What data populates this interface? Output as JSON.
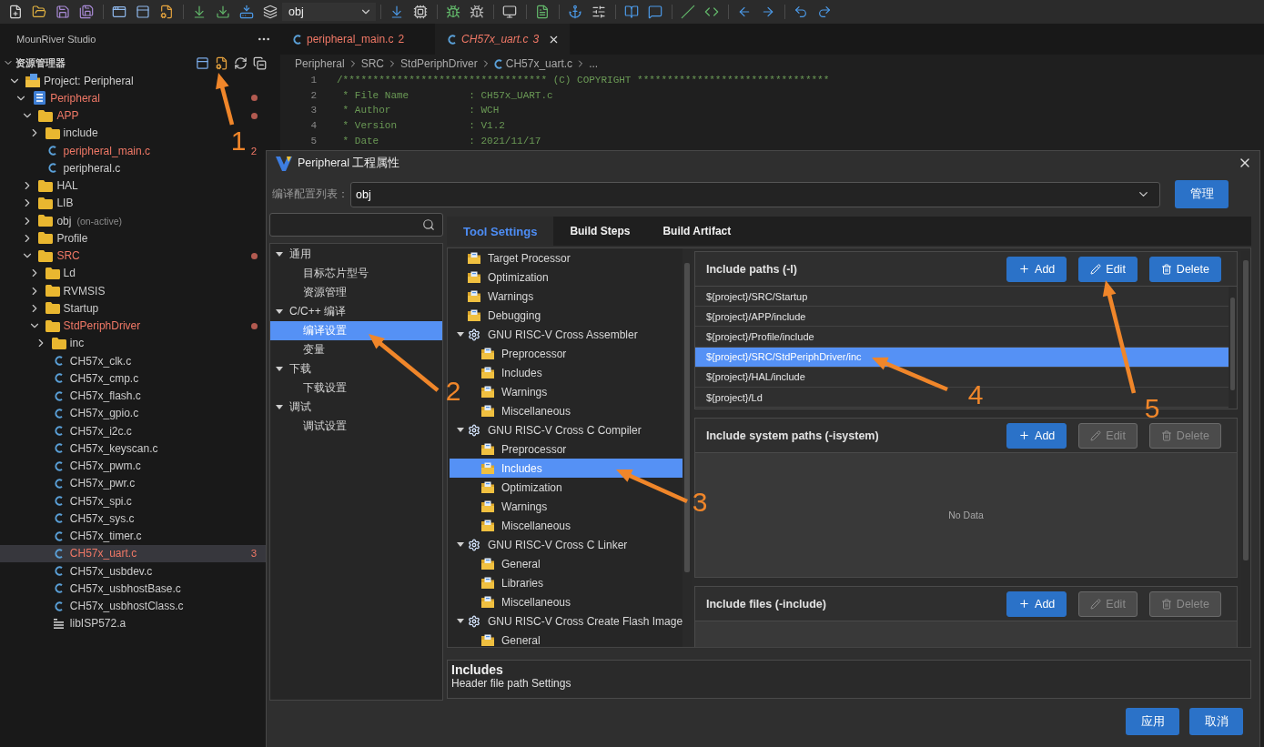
{
  "toolbar": {
    "config_value": "obj"
  },
  "sidebar": {
    "title": "MounRiver Studio",
    "section": {
      "label": "资源管理器",
      "expanded": true
    },
    "tree": [
      {
        "label": "Project: Peripheral",
        "kind": "project",
        "expanded": true,
        "selected": false,
        "error": false,
        "children": [
          {
            "label": "Peripheral",
            "kind": "build",
            "expanded": true,
            "selected": false,
            "error": true,
            "children": [
              {
                "label": "APP",
                "kind": "folder",
                "expanded": true,
                "selected": false,
                "error": true,
                "children": [
                  {
                    "label": "include",
                    "kind": "folder",
                    "expanded": false,
                    "selected": false,
                    "error": false
                  },
                  {
                    "label": "peripheral_main.c",
                    "kind": "c-file",
                    "selected": false,
                    "error": true,
                    "problems": "2"
                  },
                  {
                    "label": "peripheral.c",
                    "kind": "c-file",
                    "selected": false,
                    "error": false
                  }
                ]
              },
              {
                "label": "HAL",
                "kind": "folder",
                "expanded": false,
                "selected": false,
                "error": false
              },
              {
                "label": "LIB",
                "kind": "folder",
                "expanded": false,
                "selected": false,
                "error": false
              },
              {
                "label": "obj",
                "note": "(on-active)",
                "kind": "folder",
                "expanded": false,
                "selected": false,
                "error": false
              },
              {
                "label": "Profile",
                "kind": "folder",
                "expanded": false,
                "selected": false,
                "error": false
              },
              {
                "label": "SRC",
                "kind": "folder",
                "expanded": true,
                "selected": false,
                "error": true,
                "children": [
                  {
                    "label": "Ld",
                    "kind": "folder",
                    "expanded": false,
                    "selected": false,
                    "error": false
                  },
                  {
                    "label": "RVMSIS",
                    "kind": "folder",
                    "expanded": false,
                    "selected": false,
                    "error": false
                  },
                  {
                    "label": "Startup",
                    "kind": "folder",
                    "expanded": false,
                    "selected": false,
                    "error": false
                  },
                  {
                    "label": "StdPeriphDriver",
                    "kind": "folder",
                    "expanded": true,
                    "selected": false,
                    "error": true,
                    "children": [
                      {
                        "label": "inc",
                        "kind": "folder",
                        "expanded": false,
                        "selected": false,
                        "error": false
                      },
                      {
                        "label": "CH57x_clk.c",
                        "kind": "c-file",
                        "selected": false,
                        "error": false
                      },
                      {
                        "label": "CH57x_cmp.c",
                        "kind": "c-file",
                        "selected": false,
                        "error": false
                      },
                      {
                        "label": "CH57x_flash.c",
                        "kind": "c-file",
                        "selected": false,
                        "error": false
                      },
                      {
                        "label": "CH57x_gpio.c",
                        "kind": "c-file",
                        "selected": false,
                        "error": false
                      },
                      {
                        "label": "CH57x_i2c.c",
                        "kind": "c-file",
                        "selected": false,
                        "error": false
                      },
                      {
                        "label": "CH57x_keyscan.c",
                        "kind": "c-file",
                        "selected": false,
                        "error": false
                      },
                      {
                        "label": "CH57x_pwm.c",
                        "kind": "c-file",
                        "selected": false,
                        "error": false
                      },
                      {
                        "label": "CH57x_pwr.c",
                        "kind": "c-file",
                        "selected": false,
                        "error": false
                      },
                      {
                        "label": "CH57x_spi.c",
                        "kind": "c-file",
                        "selected": false,
                        "error": false
                      },
                      {
                        "label": "CH57x_sys.c",
                        "kind": "c-file",
                        "selected": false,
                        "error": false
                      },
                      {
                        "label": "CH57x_timer.c",
                        "kind": "c-file",
                        "selected": false,
                        "error": false
                      },
                      {
                        "label": "CH57x_uart.c",
                        "kind": "c-file",
                        "selected": true,
                        "error": true,
                        "problems": "3"
                      },
                      {
                        "label": "CH57x_usbdev.c",
                        "kind": "c-file",
                        "selected": false,
                        "error": false
                      },
                      {
                        "label": "CH57x_usbhostBase.c",
                        "kind": "c-file",
                        "selected": false,
                        "error": false
                      },
                      {
                        "label": "CH57x_usbhostClass.c",
                        "kind": "c-file",
                        "selected": false,
                        "error": false
                      },
                      {
                        "label": "libISP572.a",
                        "kind": "lib",
                        "selected": false,
                        "error": false
                      }
                    ]
                  }
                ]
              }
            ]
          }
        ]
      }
    ]
  },
  "editor": {
    "tabs": [
      {
        "label": "peripheral_main.c",
        "problems": "2",
        "error": true,
        "selected": false
      },
      {
        "label": "CH57x_uart.c",
        "problems": "3",
        "error": true,
        "selected": true
      }
    ],
    "breadcrumb": [
      {
        "label": "Peripheral",
        "kind": "folder"
      },
      {
        "label": "SRC",
        "kind": "folder"
      },
      {
        "label": "StdPeriphDriver",
        "kind": "folder"
      },
      {
        "label": "CH57x_uart.c",
        "kind": "c-file"
      },
      {
        "label": "...",
        "kind": "more"
      }
    ],
    "lines": [
      {
        "number": "1",
        "text": "/********************************** (C) COPYRIGHT ********************************"
      },
      {
        "number": "2",
        "text": " * File Name          : CH57x_UART.c"
      },
      {
        "number": "3",
        "text": " * Author             : WCH"
      },
      {
        "number": "4",
        "text": " * Version            : V1.2"
      },
      {
        "number": "5",
        "text": " * Date               : 2021/11/17"
      }
    ]
  },
  "dialog": {
    "title": "Peripheral 工程属性",
    "config": {
      "label": "编译配置列表：",
      "value": "obj",
      "button": "管理"
    },
    "categories": [
      {
        "label": "通用",
        "expanded": true,
        "selected": false,
        "children": [
          {
            "label": "目标芯片型号",
            "selected": false
          },
          {
            "label": "资源管理",
            "selected": false
          }
        ]
      },
      {
        "label": "C/C++ 编译",
        "expanded": true,
        "selected": false,
        "children": [
          {
            "label": "编译设置",
            "selected": true
          },
          {
            "label": "变量",
            "selected": false
          }
        ]
      },
      {
        "label": "下载",
        "expanded": true,
        "selected": false,
        "children": [
          {
            "label": "下载设置",
            "selected": false
          }
        ]
      },
      {
        "label": "调试",
        "expanded": true,
        "selected": false,
        "children": [
          {
            "label": "调试设置",
            "selected": false
          }
        ]
      }
    ],
    "tabs": [
      {
        "label": "Tool Settings",
        "selected": true
      },
      {
        "label": "Build Steps",
        "selected": false
      },
      {
        "label": "Build Artifact",
        "selected": false
      }
    ],
    "tool_tree": [
      {
        "label": "Target Processor",
        "kind": "option",
        "selected": false
      },
      {
        "label": "Optimization",
        "kind": "option",
        "selected": false
      },
      {
        "label": "Warnings",
        "kind": "option",
        "selected": false
      },
      {
        "label": "Debugging",
        "kind": "option",
        "selected": false
      },
      {
        "label": "GNU RISC-V Cross Assembler",
        "kind": "tool",
        "expanded": true,
        "selected": false,
        "children": [
          {
            "label": "Preprocessor",
            "kind": "option",
            "selected": false
          },
          {
            "label": "Includes",
            "kind": "option",
            "selected": false
          },
          {
            "label": "Warnings",
            "kind": "option",
            "selected": false
          },
          {
            "label": "Miscellaneous",
            "kind": "option",
            "selected": false
          }
        ]
      },
      {
        "label": "GNU RISC-V Cross C Compiler",
        "kind": "tool",
        "expanded": true,
        "selected": false,
        "children": [
          {
            "label": "Preprocessor",
            "kind": "option",
            "selected": false
          },
          {
            "label": "Includes",
            "kind": "option",
            "selected": true
          },
          {
            "label": "Optimization",
            "kind": "option",
            "selected": false
          },
          {
            "label": "Warnings",
            "kind": "option",
            "selected": false
          },
          {
            "label": "Miscellaneous",
            "kind": "option",
            "selected": false
          }
        ]
      },
      {
        "label": "GNU RISC-V Cross C Linker",
        "kind": "tool",
        "expanded": true,
        "selected": false,
        "children": [
          {
            "label": "General",
            "kind": "option",
            "selected": false
          },
          {
            "label": "Libraries",
            "kind": "option",
            "selected": false
          },
          {
            "label": "Miscellaneous",
            "kind": "option",
            "selected": false
          }
        ]
      },
      {
        "label": "GNU RISC-V Cross Create Flash Image",
        "kind": "tool",
        "expanded": true,
        "selected": false,
        "children": [
          {
            "label": "General",
            "kind": "option",
            "selected": false
          }
        ]
      }
    ],
    "sections": [
      {
        "title": "Include paths (-I)",
        "buttons": [
          {
            "label": "Add",
            "kind": "add",
            "disabled": false
          },
          {
            "label": "Edit",
            "kind": "edit",
            "disabled": false
          },
          {
            "label": "Delete",
            "kind": "delete",
            "disabled": false
          }
        ],
        "rows": [
          {
            "text": "${project}/SRC/Startup",
            "selected": false
          },
          {
            "text": "${project}/APP/include",
            "selected": false
          },
          {
            "text": "${project}/Profile/include",
            "selected": false
          },
          {
            "text": "${project}/SRC/StdPeriphDriver/inc",
            "selected": true
          },
          {
            "text": "${project}/HAL/include",
            "selected": false
          },
          {
            "text": "${project}/Ld",
            "selected": false
          }
        ]
      },
      {
        "title": "Include system paths (-isystem)",
        "buttons": [
          {
            "label": "Add",
            "kind": "add",
            "disabled": false
          },
          {
            "label": "Edit",
            "kind": "edit",
            "disabled": true
          },
          {
            "label": "Delete",
            "kind": "delete",
            "disabled": true
          }
        ],
        "empty_text": "No Data"
      },
      {
        "title": "Include files (-include)",
        "buttons": [
          {
            "label": "Add",
            "kind": "add",
            "disabled": false
          },
          {
            "label": "Edit",
            "kind": "edit",
            "disabled": true
          },
          {
            "label": "Delete",
            "kind": "delete",
            "disabled": true
          }
        ]
      }
    ],
    "description": {
      "title": "Includes",
      "text": "Header file path Settings"
    },
    "footer_buttons": [
      "应用",
      "取消"
    ]
  },
  "annotations": [
    {
      "label": "1"
    },
    {
      "label": "2"
    },
    {
      "label": "3"
    },
    {
      "label": "4"
    },
    {
      "label": "5"
    }
  ]
}
